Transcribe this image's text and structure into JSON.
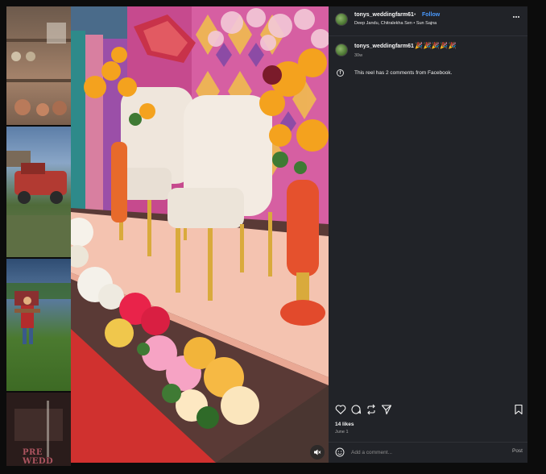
{
  "post": {
    "username": "tonys_weddingfarm61",
    "separator": "•",
    "follow_label": "Follow",
    "audio": "Deep Jandu, Chitralekha Sen • Sun Sajna",
    "more_icon": "more-horizontal-icon"
  },
  "caption": {
    "username": "tonys_weddingfarm61",
    "emojis": "🎉🎉🎉🎉🎉",
    "time": "30w"
  },
  "facebook_note": {
    "icon": "facebook-icon",
    "text": "This reel has 2 comments from Facebook."
  },
  "actions": {
    "icons": [
      "heart-icon",
      "comment-icon",
      "repost-icon",
      "share-icon",
      "bookmark-icon"
    ]
  },
  "stats": {
    "likes": "14 likes",
    "date": "June 1"
  },
  "comment_box": {
    "placeholder": "Add a comment...",
    "post_label": "Post",
    "emoji_icon": "emoji-icon"
  },
  "background_thumbnail": {
    "text": "PRE WEDD SHOOT"
  },
  "colors": {
    "panel_bg": "#212328",
    "page_bg": "#0c0c0c",
    "follow_blue": "#4a9bff"
  }
}
